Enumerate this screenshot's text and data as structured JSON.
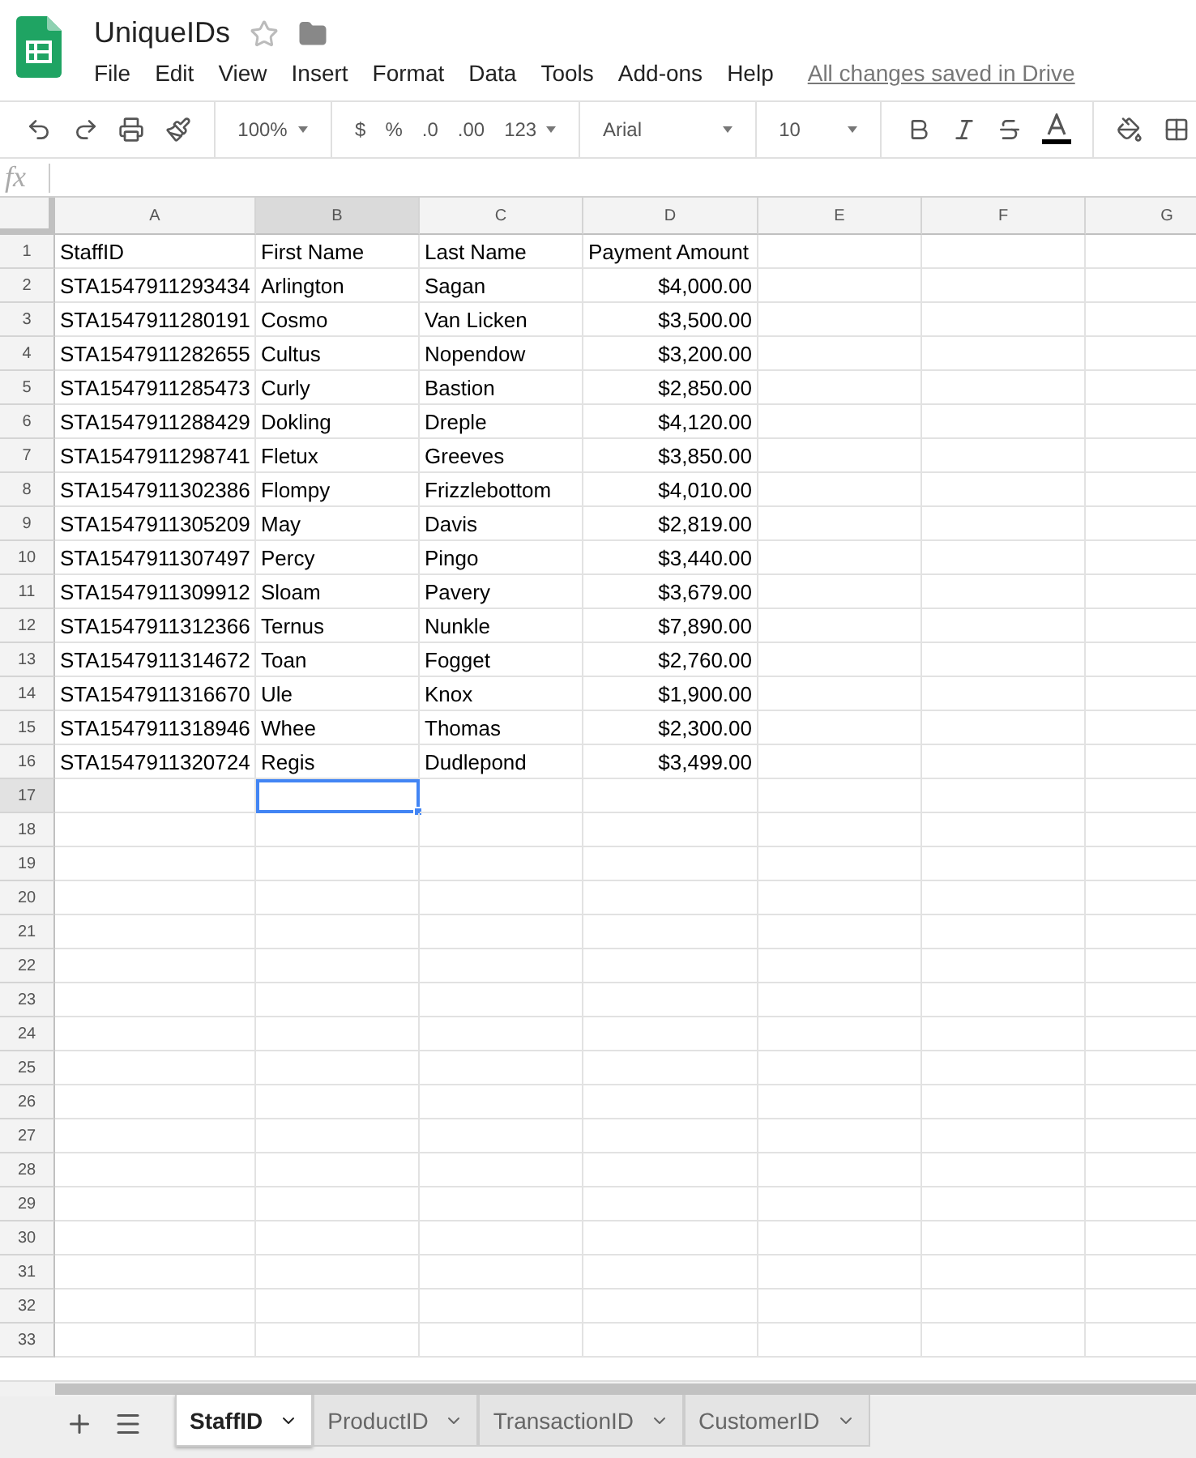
{
  "document": {
    "title": "UniqueIDs",
    "starred": false
  },
  "menu": [
    "File",
    "Edit",
    "View",
    "Insert",
    "Format",
    "Data",
    "Tools",
    "Add-ons",
    "Help"
  ],
  "save_status": "All changes saved in Drive",
  "toolbar": {
    "zoom": "100%",
    "currency": "$",
    "percent": "%",
    "decrease_decimals": ".0",
    "increase_decimals": ".00",
    "more_formats": "123",
    "font": "Arial",
    "font_size": "10"
  },
  "formula_bar": {
    "label": "fx"
  },
  "columns": [
    {
      "letter": "A",
      "selected": false,
      "numeric": false
    },
    {
      "letter": "B",
      "selected": true,
      "numeric": false
    },
    {
      "letter": "C",
      "selected": false,
      "numeric": false
    },
    {
      "letter": "D",
      "selected": false,
      "numeric": true
    },
    {
      "letter": "E",
      "selected": false,
      "numeric": false
    },
    {
      "letter": "F",
      "selected": false,
      "numeric": false
    },
    {
      "letter": "G",
      "selected": false,
      "numeric": false
    }
  ],
  "rows": [
    {
      "number": "1",
      "kind": "header",
      "selected": false,
      "cells": [
        "StaffID",
        "First Name",
        "Last Name",
        "Payment Amount"
      ]
    },
    {
      "number": "2",
      "kind": "data",
      "selected": false,
      "cells": [
        "STA1547911293434",
        "Arlington",
        "Sagan",
        "$4,000.00"
      ]
    },
    {
      "number": "3",
      "kind": "data",
      "selected": false,
      "cells": [
        "STA1547911280191",
        "Cosmo",
        "Van Licken",
        "$3,500.00"
      ]
    },
    {
      "number": "4",
      "kind": "data",
      "selected": false,
      "cells": [
        "STA1547911282655",
        "Cultus",
        "Nopendow",
        "$3,200.00"
      ]
    },
    {
      "number": "5",
      "kind": "data",
      "selected": false,
      "cells": [
        "STA1547911285473",
        "Curly",
        "Bastion",
        "$2,850.00"
      ]
    },
    {
      "number": "6",
      "kind": "data",
      "selected": false,
      "cells": [
        "STA1547911288429",
        "Dokling",
        "Dreple",
        "$4,120.00"
      ]
    },
    {
      "number": "7",
      "kind": "data",
      "selected": false,
      "cells": [
        "STA1547911298741",
        "Fletux",
        "Greeves",
        "$3,850.00"
      ]
    },
    {
      "number": "8",
      "kind": "data",
      "selected": false,
      "cells": [
        "STA1547911302386",
        "Flompy",
        "Frizzlebottom",
        "$4,010.00"
      ]
    },
    {
      "number": "9",
      "kind": "data",
      "selected": false,
      "cells": [
        "STA1547911305209",
        "May",
        "Davis",
        "$2,819.00"
      ]
    },
    {
      "number": "10",
      "kind": "data",
      "selected": false,
      "cells": [
        "STA1547911307497",
        "Percy",
        "Pingo",
        "$3,440.00"
      ]
    },
    {
      "number": "11",
      "kind": "data",
      "selected": false,
      "cells": [
        "STA1547911309912",
        "Sloam",
        "Pavery",
        "$3,679.00"
      ]
    },
    {
      "number": "12",
      "kind": "data",
      "selected": false,
      "cells": [
        "STA1547911312366",
        "Ternus",
        "Nunkle",
        "$7,890.00"
      ]
    },
    {
      "number": "13",
      "kind": "data",
      "selected": false,
      "cells": [
        "STA1547911314672",
        "Toan",
        "Fogget",
        "$2,760.00"
      ]
    },
    {
      "number": "14",
      "kind": "data",
      "selected": false,
      "cells": [
        "STA1547911316670",
        "Ule",
        "Knox",
        "$1,900.00"
      ]
    },
    {
      "number": "15",
      "kind": "data",
      "selected": false,
      "cells": [
        "STA1547911318946",
        "Whee",
        "Thomas",
        "$2,300.00"
      ]
    },
    {
      "number": "16",
      "kind": "data",
      "selected": false,
      "cells": [
        "STA1547911320724",
        "Regis",
        "Dudlepond",
        "$3,499.00"
      ]
    },
    {
      "number": "17",
      "kind": "data",
      "selected": true
    },
    {
      "number": "18",
      "kind": "data",
      "selected": false
    },
    {
      "number": "19",
      "kind": "data",
      "selected": false
    },
    {
      "number": "20",
      "kind": "data",
      "selected": false
    },
    {
      "number": "21",
      "kind": "data",
      "selected": false
    },
    {
      "number": "22",
      "kind": "data",
      "selected": false
    },
    {
      "number": "23",
      "kind": "data",
      "selected": false
    },
    {
      "number": "24",
      "kind": "data",
      "selected": false
    },
    {
      "number": "25",
      "kind": "data",
      "selected": false
    },
    {
      "number": "26",
      "kind": "data",
      "selected": false
    },
    {
      "number": "27",
      "kind": "data",
      "selected": false
    },
    {
      "number": "28",
      "kind": "data",
      "selected": false
    },
    {
      "number": "29",
      "kind": "data",
      "selected": false
    },
    {
      "number": "30",
      "kind": "data",
      "selected": false
    },
    {
      "number": "31",
      "kind": "data",
      "selected": false
    },
    {
      "number": "32",
      "kind": "data",
      "selected": false
    },
    {
      "number": "33",
      "kind": "data",
      "selected": false
    }
  ],
  "sheets": [
    {
      "label": "StaffID",
      "selected": true
    },
    {
      "label": "ProductID",
      "selected": false
    },
    {
      "label": "TransactionID",
      "selected": false
    },
    {
      "label": "CustomerID",
      "selected": false
    }
  ]
}
